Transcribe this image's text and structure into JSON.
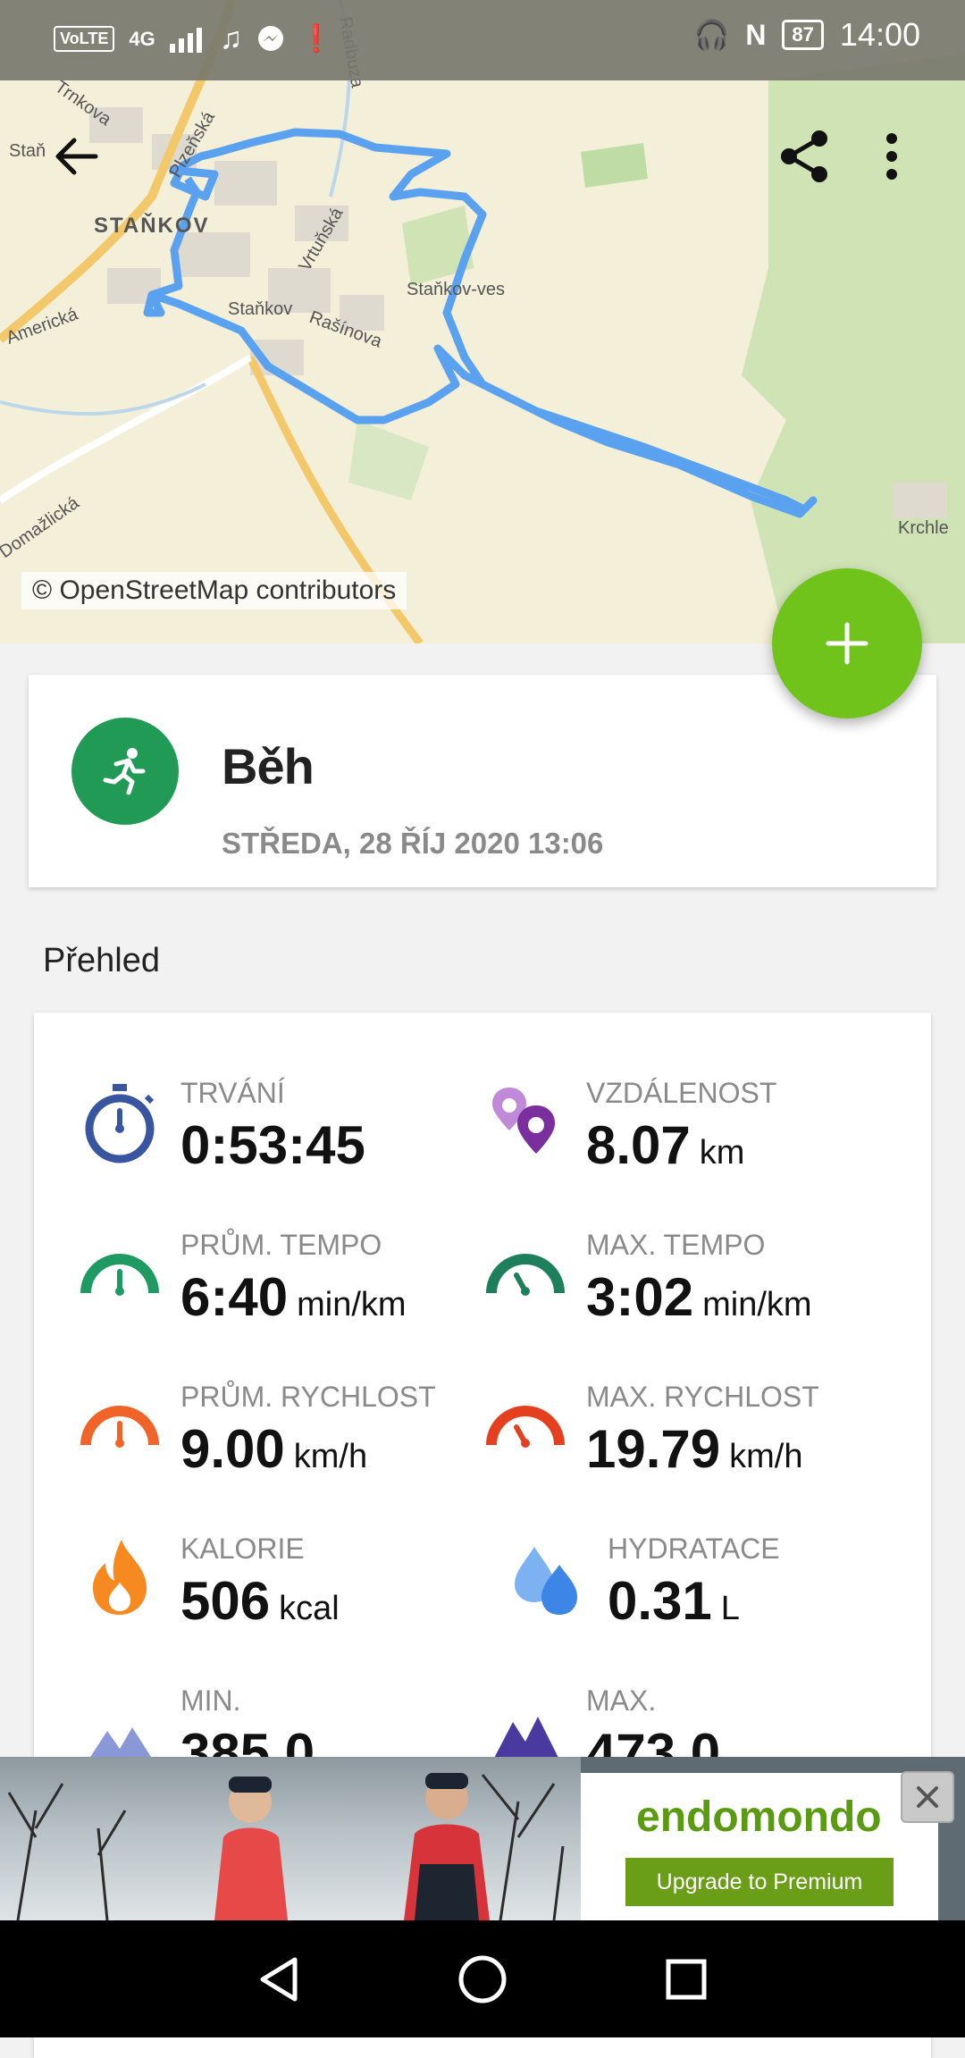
{
  "status_bar": {
    "network_badges": [
      "VoLTE",
      "4G"
    ],
    "battery": "87",
    "time": "14:00"
  },
  "map": {
    "attribution": "© OpenStreetMap contributors",
    "labels": [
      "Trnkova",
      "Staň",
      "STAŇKOV",
      "Plzeňská",
      "Americká",
      "Staňkov",
      "Rašínova",
      "Vrtuňská",
      "Staňkov-ves",
      "Domažlická",
      "Krchle",
      "Radbuza"
    ],
    "route_color": "#5aa2f0"
  },
  "activity": {
    "title": "Běh",
    "date": "STŘEDA, 28 ŘÍJ 2020 13:06"
  },
  "section": {
    "title": "Přehled"
  },
  "stats": [
    {
      "label": "TRVÁNÍ",
      "value": "0:53:45",
      "unit": "",
      "icon": "stopwatch-icon"
    },
    {
      "label": "VZDÁLENOST",
      "value": "8.07",
      "unit": "km",
      "icon": "location-pins-icon"
    },
    {
      "label": "PRŮM. TEMPO",
      "value": "6:40",
      "unit": "min/km",
      "icon": "pace-gauge-icon"
    },
    {
      "label": "MAX. TEMPO",
      "value": "3:02",
      "unit": "min/km",
      "icon": "max-pace-gauge-icon"
    },
    {
      "label": "PRŮM. RYCHLOST",
      "value": "9.00",
      "unit": "km/h",
      "icon": "speed-gauge-icon"
    },
    {
      "label": "MAX. RYCHLOST",
      "value": "19.79",
      "unit": "km/h",
      "icon": "max-speed-gauge-icon"
    },
    {
      "label": "KALORIE",
      "value": "506",
      "unit": "kcal",
      "icon": "flame-icon"
    },
    {
      "label": "HYDRATACE",
      "value": "0.31",
      "unit": "L",
      "icon": "water-drops-icon"
    },
    {
      "label": "MIN.",
      "value": "385.0",
      "unit": "",
      "icon": "mountain-min-icon"
    },
    {
      "label": "MAX.",
      "value": "473.0",
      "unit": "",
      "icon": "mountain-max-icon"
    }
  ],
  "ad": {
    "brand": "endomondo",
    "cta": "Upgrade to Premium"
  },
  "colors": {
    "accent_green": "#70c31b",
    "activity_green": "#219a56",
    "route_blue": "#5aa2f0"
  }
}
